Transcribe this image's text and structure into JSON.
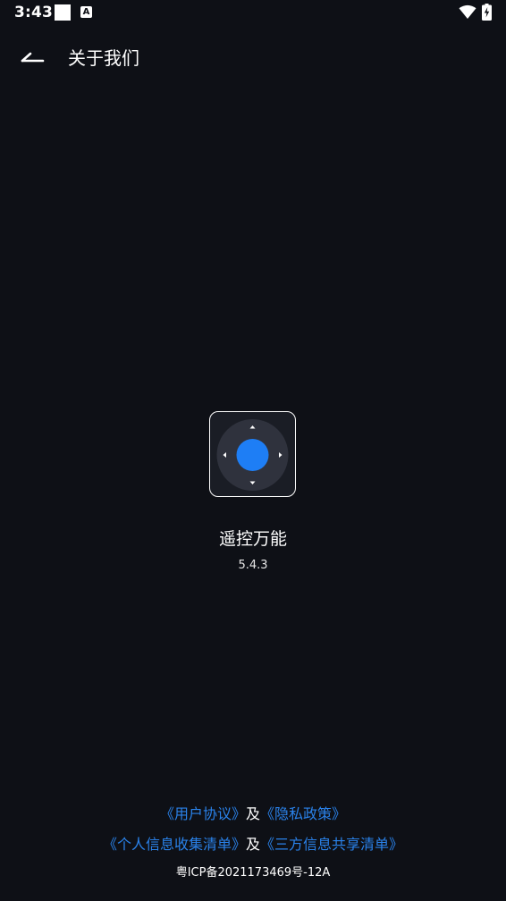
{
  "status_bar": {
    "time": "3:43",
    "notification_badge": "A",
    "icons": [
      "square-notification-icon",
      "a-notification-icon",
      "wifi-icon",
      "battery-charging-icon"
    ]
  },
  "header": {
    "back_icon": "back-arrow-icon",
    "title": "关于我们"
  },
  "app": {
    "icon": "remote-dpad-icon",
    "name": "遥控万能",
    "version": "5.4.3"
  },
  "footer": {
    "user_agreement": "《用户协议》",
    "and_1": "及",
    "privacy_policy": "《隐私政策》",
    "personal_info_list": "《个人信息收集清单》",
    "and_2": "及",
    "third_party_list": "《三方信息共享清单》",
    "icp": "粤ICP备2021173469号-12A"
  },
  "colors": {
    "background": "#0e1016",
    "link": "#2a82ea",
    "accent_blue": "#1e7ef5",
    "dpad_ring": "#2f323d"
  }
}
